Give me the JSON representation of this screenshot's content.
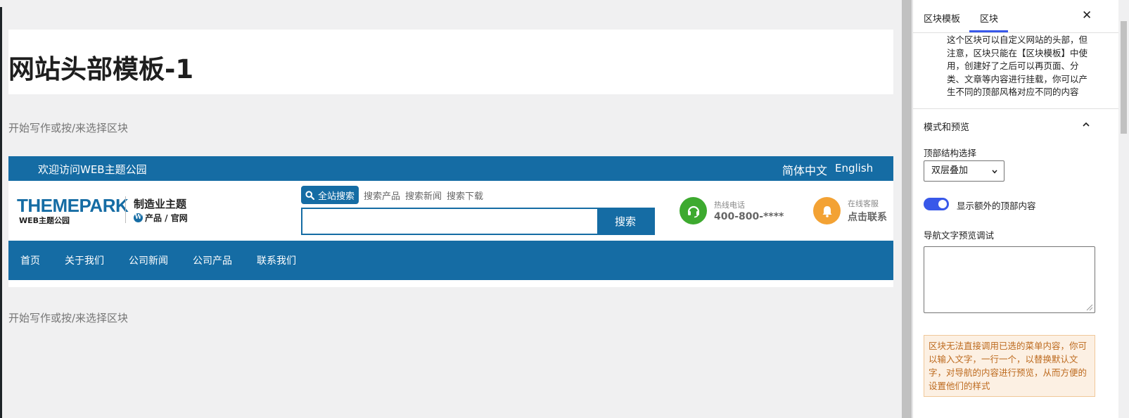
{
  "editor": {
    "page_title": "网站头部模板-1",
    "placeholder_top": "开始写作或按/来选择区块",
    "placeholder_bottom": "开始写作或按/来选择区块"
  },
  "header_preview": {
    "welcome": "欢迎访问WEB主题公园",
    "lang_cn": "简体中文",
    "lang_en": "English",
    "logo": {
      "main": "THEMEPARK",
      "sub": "WEB主题公园",
      "tagline": "制造业主题",
      "tagline2": "产品 / 官网"
    },
    "search": {
      "tabs": [
        "全站搜索",
        "搜索产品",
        "搜索新闻",
        "搜索下载"
      ],
      "button": "搜索"
    },
    "contacts": {
      "phone_label": "热线电话",
      "phone_value": "400-800-****",
      "service_label": "在线客服",
      "service_value": "点击联系"
    },
    "nav": [
      "首页",
      "关于我们",
      "公司新闻",
      "公司产品",
      "联系我们"
    ],
    "colors": {
      "primary": "#156ca4",
      "phone": "#3daa2f",
      "service": "#f3a234"
    }
  },
  "sidebar": {
    "tabs": [
      "区块模板",
      "区块"
    ],
    "active_tab": "区块",
    "close": "✕",
    "description": "这个区块可以自定义网站的头部，但注意，区块只能在【区块模板】中使用，创建好了之后可以再页面、分类、文章等内容进行挂载，你可以产生不同的顶部风格对应不同的内容",
    "panel": {
      "title": "模式和预览",
      "structure_label": "顶部结构选择",
      "structure_value": "双层叠加",
      "toggle_label": "显示额外的顶部内容",
      "toggle_on": true,
      "nav_preview_label": "导航文字预览调试",
      "nav_preview_value": "",
      "notice": "区块无法直接调用已选的菜单内容，你可以输入文字，一行一个，以替换默认文字，对导航的内容进行预览，从而方便的设置他们的样式"
    }
  }
}
